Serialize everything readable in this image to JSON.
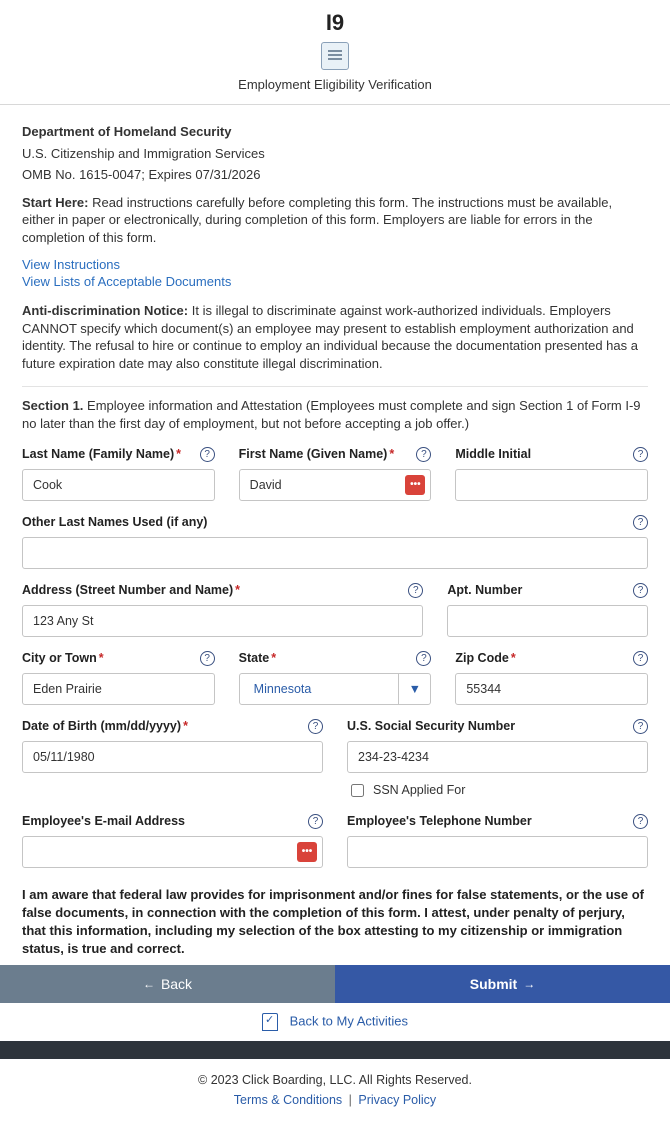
{
  "header": {
    "title": "I9",
    "subtitle": "Employment Eligibility Verification"
  },
  "intro": {
    "dept": "Department of Homeland Security",
    "agency": "U.S. Citizenship and Immigration Services",
    "omb": "OMB No. 1615-0047; Expires 07/31/2026",
    "start_here_label": "Start Here:",
    "start_here_text": " Read instructions carefully before completing this form. The instructions must be available, either in paper or electronically, during completion of this form. Employers are liable for errors in the completion of this form.",
    "view_instructions": "View Instructions",
    "view_lists": "View Lists of Acceptable Documents",
    "anti_label": "Anti-discrimination Notice:",
    "anti_text": " It is illegal to discriminate against work-authorized individuals. Employers CANNOT specify which document(s) an employee may present to establish employment authorization and identity. The refusal to hire or continue to employ an individual because the documentation presented has a future expiration date may also constitute illegal discrimination."
  },
  "section1": {
    "label": "Section 1.",
    "text": " Employee information and Attestation (Employees must complete and sign Section 1 of Form I-9 no later than the first day of employment, but not before accepting a job offer.)"
  },
  "fields": {
    "last_name": {
      "label": "Last Name (Family Name)",
      "value": "Cook"
    },
    "first_name": {
      "label": "First Name (Given Name)",
      "value": "David"
    },
    "middle_initial": {
      "label": "Middle Initial",
      "value": ""
    },
    "other_names": {
      "label": "Other Last Names Used (if any)",
      "value": ""
    },
    "address": {
      "label": "Address (Street Number and Name)",
      "value": "123 Any St"
    },
    "apt": {
      "label": "Apt. Number",
      "value": ""
    },
    "city": {
      "label": "City or Town",
      "value": "Eden Prairie"
    },
    "state": {
      "label": "State",
      "value": "Minnesota"
    },
    "zip": {
      "label": "Zip Code",
      "value": "55344"
    },
    "dob": {
      "label": "Date of Birth (mm/dd/yyyy)",
      "value": "05/11/1980"
    },
    "ssn": {
      "label": "U.S. Social Security Number",
      "value": "234-23-4234"
    },
    "ssn_applied": {
      "label": "SSN Applied For"
    },
    "email": {
      "label": "Employee's E-mail Address",
      "value": ""
    },
    "phone": {
      "label": "Employee's Telephone Number",
      "value": ""
    }
  },
  "attestation": "I am aware that federal law provides for imprisonment and/or fines for false statements, or the use of false documents, in connection with the completion of this form. I attest, under penalty of perjury, that this information, including my selection of the box attesting to my citizenship or immigration status, is true and correct.",
  "buttons": {
    "back": "Back",
    "submit": "Submit",
    "back_activities": "Back to My Activities"
  },
  "footer": {
    "copyright": "© 2023 Click Boarding, LLC. All Rights Reserved.",
    "terms": "Terms & Conditions",
    "privacy": "Privacy Policy"
  }
}
